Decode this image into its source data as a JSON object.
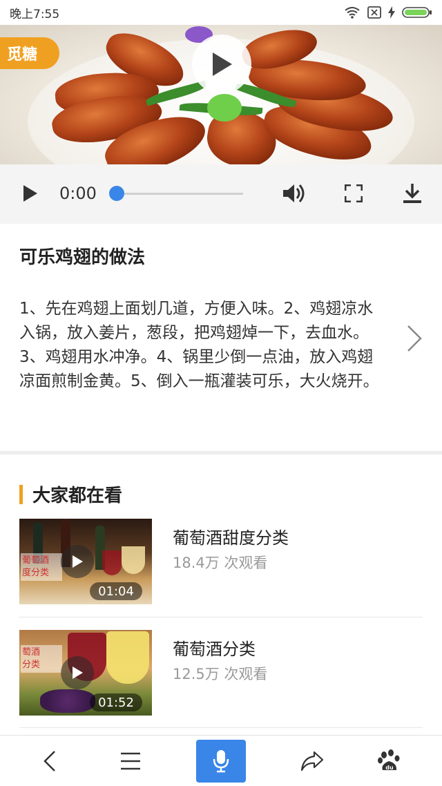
{
  "status_bar": {
    "time": "晚上7:55"
  },
  "video": {
    "badge": "觅糖",
    "time": "0:00",
    "progress": 0
  },
  "article": {
    "title": "可乐鸡翅的做法",
    "description": "1、先在鸡翅上面划几道，方便入味。2、鸡翅凉水入锅，放入姜片，葱段，把鸡翅焯一下，去血水。3、鸡翅用水冲净。4、锅里少倒一点油，放入鸡翅凉面煎制金黄。5、倒入一瓶灌装可乐，大火烧开。"
  },
  "related": {
    "title": "大家都在看",
    "items": [
      {
        "title": "葡萄酒甜度分类",
        "views": "18.4万 次观看",
        "duration": "01:04",
        "thumb_text": "葡萄酒\n度分类"
      },
      {
        "title": "葡萄酒分类",
        "views": "12.5万 次观看",
        "duration": "01:52",
        "thumb_text": "萄酒\n分类"
      }
    ]
  },
  "colors": {
    "accent": "#3a86e8",
    "brand": "#f0a020"
  },
  "bottom_nav": [
    "back-icon",
    "menu-icon",
    "microphone-icon",
    "share-icon",
    "baidu-paw-icon"
  ]
}
